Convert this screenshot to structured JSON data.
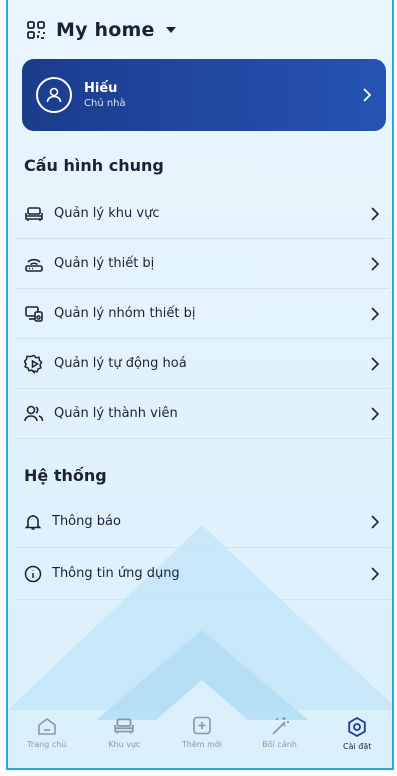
{
  "header": {
    "home_name": "My home",
    "icons": [
      "qr-scan-icon",
      "caret-down-icon"
    ]
  },
  "profile": {
    "name": "Hiếu",
    "role": "Chủ nhà",
    "icons": [
      "user-icon",
      "chevron-right-icon"
    ]
  },
  "sections": {
    "general": {
      "title": "Cấu hình chung",
      "items": [
        {
          "label": "Quản lý khu vực",
          "icon": "sofa-icon"
        },
        {
          "label": "Quản lý thiết bị",
          "icon": "router-icon"
        },
        {
          "label": "Quản lý nhóm thiết bị",
          "icon": "device-group-icon"
        },
        {
          "label": "Quản lý tự động hoá",
          "icon": "automation-gear-icon"
        },
        {
          "label": "Quản lý thành viên",
          "icon": "members-icon"
        }
      ]
    },
    "system": {
      "title": "Hệ thống",
      "items": [
        {
          "label": "Thông báo",
          "icon": "bell-icon"
        },
        {
          "label": "Thông tin ứng dụng",
          "icon": "info-icon"
        }
      ]
    }
  },
  "tabbar": {
    "active": "Cài đặt",
    "tabs": [
      {
        "label": "Trang chủ",
        "icon": "home-icon"
      },
      {
        "label": "Khu vực",
        "icon": "sofa-icon"
      },
      {
        "label": "Thêm mới",
        "icon": "add-square-icon"
      },
      {
        "label": "Bối cảnh",
        "icon": "magic-wand-icon"
      },
      {
        "label": "Cài đặt",
        "icon": "settings-hex-icon"
      }
    ]
  },
  "colors": {
    "accent": "#25a9e6",
    "profile_bg": "#2147a3",
    "text": "#1d2233",
    "muted": "#8b96a5"
  }
}
